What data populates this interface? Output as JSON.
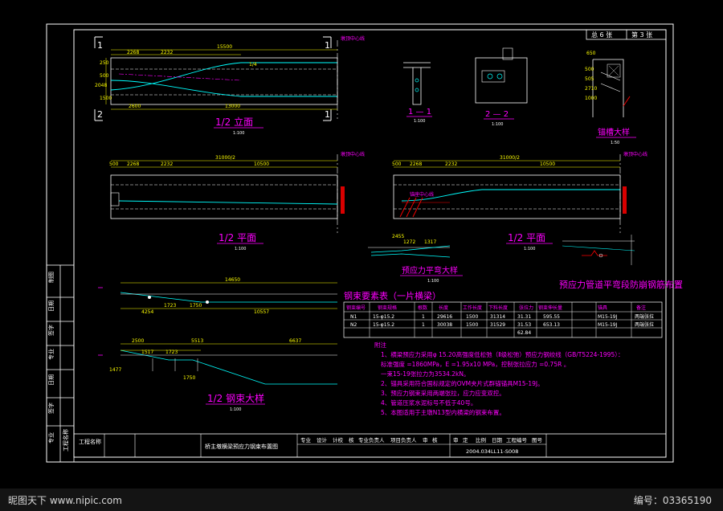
{
  "sheet": {
    "total": "总 6 张",
    "sheet_no": "第 3 张"
  },
  "colors": {
    "background": "#000000",
    "frame": "#ffffff",
    "label": "#ff00ff",
    "dim": "#ffff00",
    "line": "#00ffff",
    "hatch": "#ff0000"
  },
  "elevation": {
    "title": "1/2 立面",
    "scale": "1:100",
    "section_left_top": "1",
    "section_left_bottom": "2",
    "section_right_top": "1",
    "section_right_bottom": "1",
    "pier_center": "墩顶中心线",
    "dims": [
      "2268",
      "2232",
      "15500",
      "1/4",
      "2600",
      "13000",
      "2048",
      "250",
      "500",
      "1500"
    ]
  },
  "plan_left": {
    "title": "1/2 平面",
    "scale": "1:100",
    "pier_center": "墩顶中心线",
    "dims": [
      "500",
      "2268",
      "2232",
      "31000/2",
      "10500"
    ]
  },
  "plan_right": {
    "title": "1/2 平面",
    "scale": "1:100",
    "pier_center": "墩顶中心线",
    "dims": [
      "500",
      "2268",
      "2232",
      "31000/2",
      "10500"
    ],
    "note": "锚座中心线"
  },
  "section_1": {
    "title": "1 — 1",
    "scale": "1:100"
  },
  "section_2": {
    "title": "2 — 2",
    "scale": "1:100"
  },
  "anchor": {
    "title": "锚槽大样",
    "scale": "1:50",
    "dims": [
      "650",
      "500",
      "505",
      "2710",
      "1000",
      "1000",
      "1000"
    ]
  },
  "flat_bend": {
    "title": "预应力平弯大样",
    "scale": "1:100",
    "dims": [
      "2455",
      "1272",
      "1317"
    ]
  },
  "duct_rebar_title": "预应力管道平弯段防崩钢筋布置",
  "tendon_elev": {
    "dims": [
      "14650",
      "4254",
      "1723",
      "1750",
      "10557"
    ]
  },
  "tendon_detail": {
    "title": "1/2 钢束大样",
    "scale": "1:100",
    "dims": [
      "2500",
      "5513",
      "6637",
      "1517",
      "1723",
      "1477",
      "1750"
    ]
  },
  "table": {
    "title": "钢束要素表（一片横梁）",
    "headers": [
      "钢束编号",
      "钢束规格",
      "根数",
      "长度",
      "工作长度",
      "下料长度",
      "张拉力",
      "钢束伸长量",
      "锚具",
      "备注"
    ],
    "rows": [
      [
        "N1",
        "15-φ15.2",
        "1",
        "29616",
        "1500",
        "31314",
        "31.31",
        "595.55",
        "M15-19J",
        "两端张拉"
      ],
      [
        "N2",
        "15-φ15.2",
        "1",
        "30038",
        "1500",
        "31529",
        "31.53",
        "653.13",
        "M15-19J",
        "两端张拉"
      ]
    ],
    "total": "62.84"
  },
  "notes": {
    "heading": "附注",
    "lines": [
      "1、横梁预应力采用φ 15.20高强度低松弛（Ⅱ级松弛）预应力钢绞线（GB/T5224-1995）：",
      "   标准强度 =1860MPa，E =1.95x10 MPa，控制张拉应力 =0.75R 。",
      "   一束15-19张拉力为3534.2kN。",
      "2、锚具采用符合国标规定的OVM夹片式群锚锚具M15-19J。",
      "3、预应力钢束采用两端张拉，应力应变双控。",
      "4、管道压浆水泥标号不低于40号。",
      "5、本图适用于主墩N13型内横梁的钢束布置。"
    ]
  },
  "title_block": {
    "drawing_title": "桥主墩横梁预应力钢束布置图",
    "roles": [
      "专业",
      "设计",
      "计校",
      "核",
      "专业负责人",
      "项目负责人",
      "审",
      "核",
      "审",
      "定"
    ],
    "ratio_label": "比例",
    "date_label": "日期",
    "project_no_label": "工程编号",
    "drawing_no_label": "图号",
    "drawing_no": "2004.034LL11-S008",
    "left_strip": [
      "制图",
      "日期",
      "签字",
      "专业",
      "日期",
      "签字",
      "专业",
      "工程名称"
    ]
  },
  "watermark": {
    "left": "昵图天下 www.nipic.com",
    "right": "编号：03365190"
  }
}
